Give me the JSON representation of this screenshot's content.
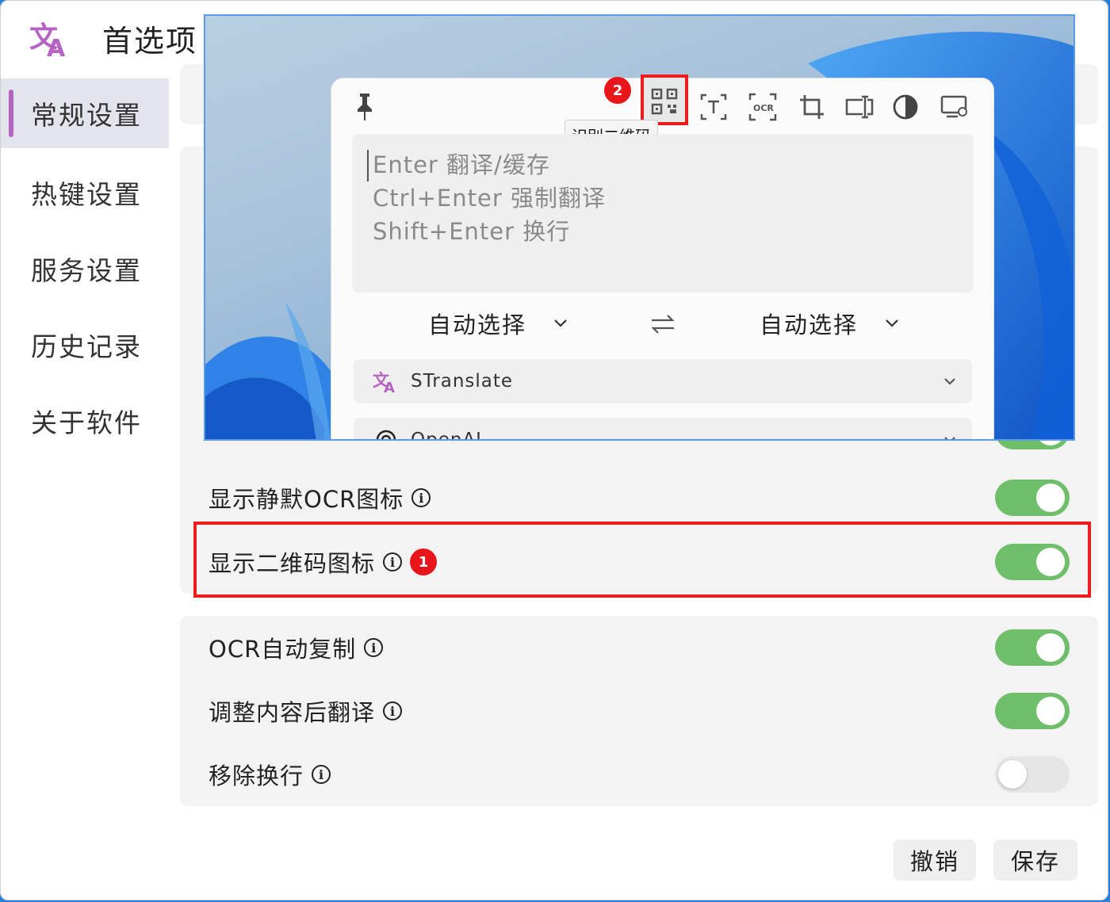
{
  "app": {
    "title": "首选项"
  },
  "sidebar": {
    "items": [
      {
        "label": "常规设置",
        "active": true
      },
      {
        "label": "热键设置"
      },
      {
        "label": "服务设置"
      },
      {
        "label": "历史记录"
      },
      {
        "label": "关于软件"
      }
    ]
  },
  "settings": {
    "rows": [
      {
        "label": "显示静默OCR图标",
        "on": true
      },
      {
        "label": "显示二维码图标",
        "on": true,
        "badge": "1"
      },
      {
        "label": "OCR自动复制",
        "on": true
      },
      {
        "label": "调整内容后翻译",
        "on": true
      },
      {
        "label": "移除换行",
        "on": false
      }
    ],
    "info_glyph": "i"
  },
  "footer": {
    "cancel": "撤销",
    "save": "保存"
  },
  "popup": {
    "badge": "2",
    "tooltip": "识别二维码",
    "toolbar_icons": [
      "pin-icon",
      "qr-code-icon",
      "text-select-icon",
      "ocr-icon",
      "crop-icon",
      "input-box-icon",
      "contrast-icon",
      "screen-settings-icon"
    ],
    "input_lines": [
      "Enter 翻译/缓存",
      "Ctrl+Enter 强制翻译",
      "Shift+Enter 换行"
    ],
    "source_lang": "自动选择",
    "target_lang": "自动选择",
    "services": [
      {
        "name": "STranslate",
        "icon": "stranslate-icon"
      },
      {
        "name": "OpenAI",
        "icon": "openai-icon"
      }
    ]
  },
  "colors": {
    "accent": "#b664c4",
    "toggle_on": "#6fbf6a",
    "highlight": "#ee1c1c"
  }
}
